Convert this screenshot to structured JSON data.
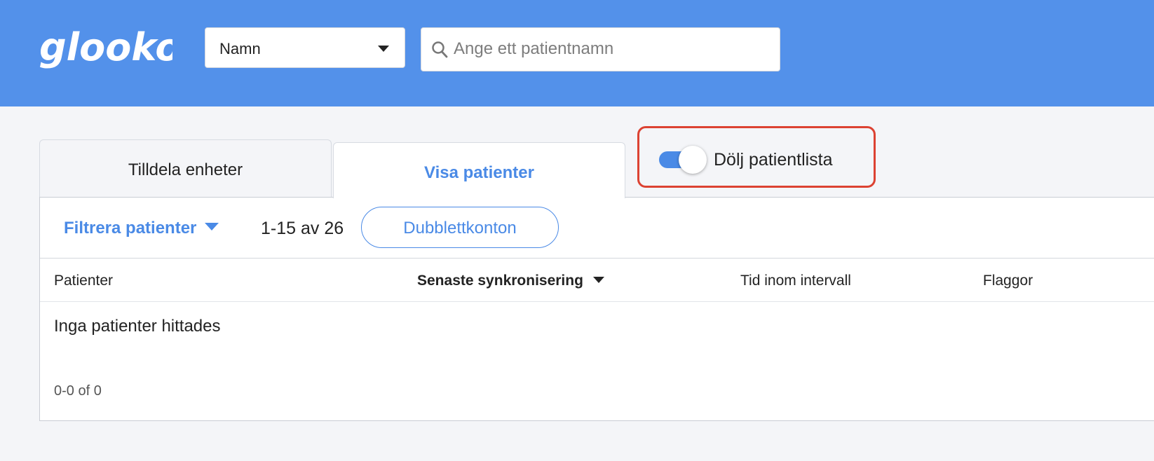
{
  "header": {
    "logo_text": "glooko",
    "search_type": {
      "selected": "Namn"
    },
    "search": {
      "placeholder": "Ange ett patientnamn"
    },
    "colors": {
      "bar": "#5391ea",
      "accent": "#4a8ae6",
      "highlight": "#dc4232"
    }
  },
  "tabs": [
    {
      "label": "Tilldela enheter",
      "active": false
    },
    {
      "label": "Visa patienter",
      "active": true
    }
  ],
  "toggle": {
    "label": "Dölj patientlista",
    "on": true,
    "icon": "toggle-switch-icon"
  },
  "toolbar": {
    "filter_label": "Filtrera patienter",
    "filter_icon": "caret-down-icon",
    "range_text": "1-15 av 26",
    "duplicate_label": "Dubblettkonton"
  },
  "table": {
    "columns": [
      {
        "label": "Patienter",
        "sorted": false
      },
      {
        "label": "Senaste synkronisering",
        "sorted": true,
        "sort_icon": "caret-down-icon"
      },
      {
        "label": "Tid inom intervall",
        "sorted": false
      },
      {
        "label": "Flaggor",
        "sorted": false
      }
    ],
    "empty_message": "Inga patienter hittades",
    "pager_text": "0-0 of 0"
  }
}
